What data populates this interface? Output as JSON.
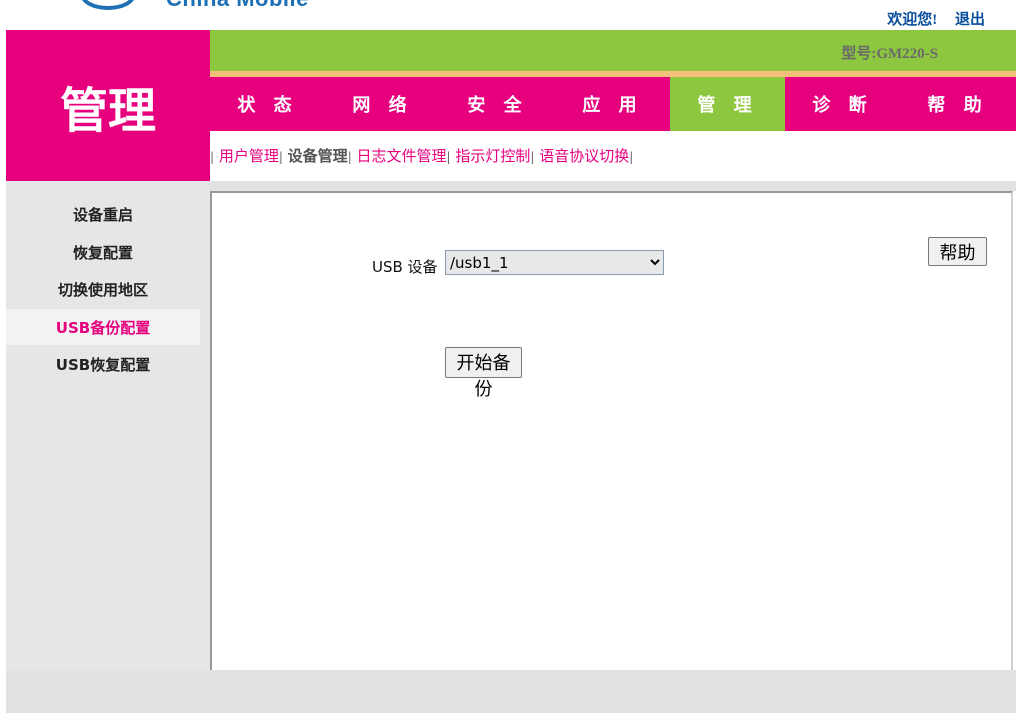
{
  "header": {
    "logo_text": "China Mobile",
    "welcome": "欢迎您!",
    "logout": "退出",
    "model_label": "型号:GM220-S"
  },
  "section_title": "管理",
  "nav": {
    "tabs": [
      {
        "label": "状 态"
      },
      {
        "label": "网 络"
      },
      {
        "label": "安 全"
      },
      {
        "label": "应 用"
      },
      {
        "label": "管 理",
        "active": true
      },
      {
        "label": "诊 断"
      },
      {
        "label": "帮 助"
      }
    ]
  },
  "subnav": {
    "items": [
      {
        "label": "用户管理"
      },
      {
        "label": "设备管理",
        "current": true
      },
      {
        "label": "日志文件管理"
      },
      {
        "label": "指示灯控制"
      },
      {
        "label": "语音协议切换"
      }
    ]
  },
  "sidebar": {
    "items": [
      {
        "label": "设备重启"
      },
      {
        "label": "恢复配置"
      },
      {
        "label": "切换使用地区"
      },
      {
        "label": "USB备份配置",
        "active": true
      },
      {
        "label": "USB恢复配置"
      }
    ]
  },
  "main": {
    "usb_label": "USB 设备",
    "usb_select_value": "/usb1_1",
    "help_button": "帮助",
    "start_button": "开始备份"
  },
  "colors": {
    "brand_magenta": "#e6007e",
    "brand_green": "#8dc63f",
    "logo_blue": "#1f6fb5"
  }
}
